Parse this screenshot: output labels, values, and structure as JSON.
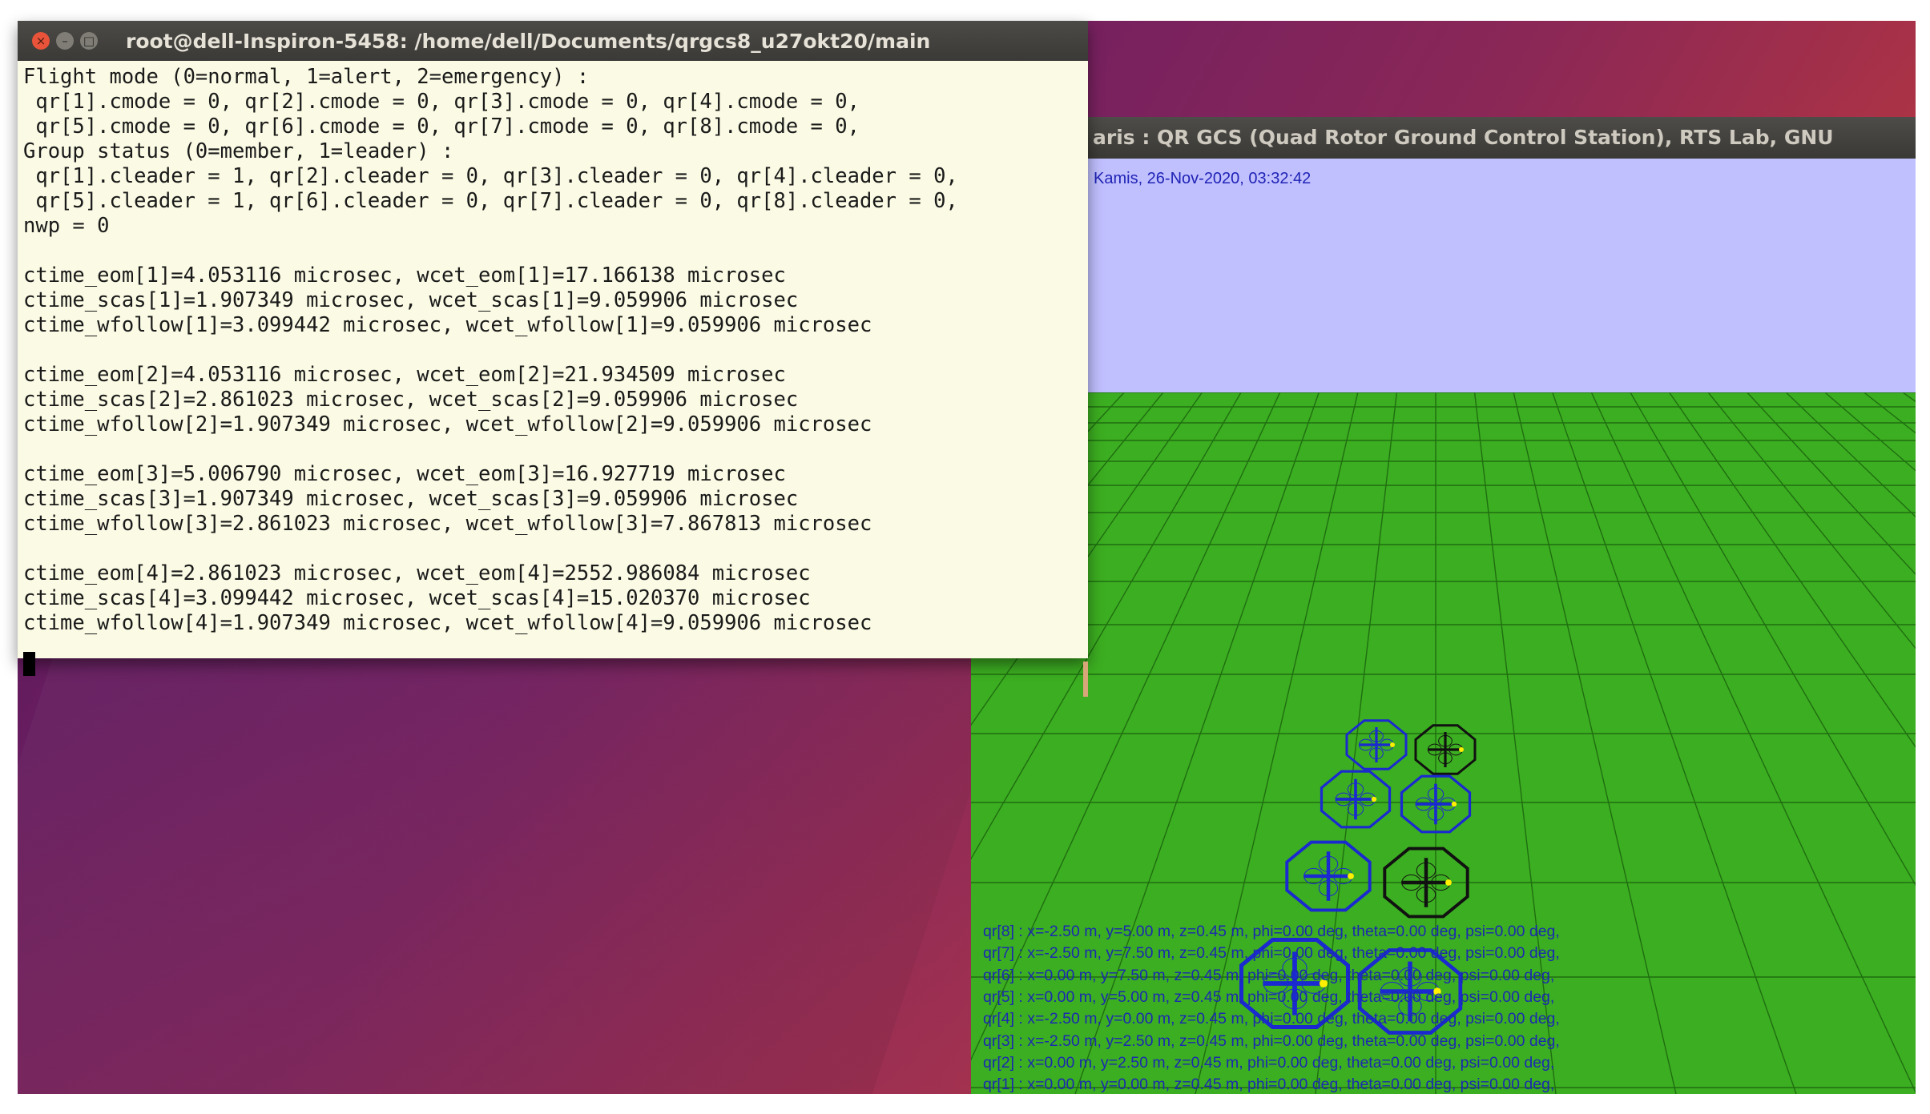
{
  "terminal": {
    "title": "root@dell-Inspiron-5458: /home/dell/Documents/qrgcs8_u27okt20/main",
    "lines": [
      "Flight mode (0=normal, 1=alert, 2=emergency) :",
      " qr[1].cmode = 0, qr[2].cmode = 0, qr[3].cmode = 0, qr[4].cmode = 0,",
      " qr[5].cmode = 0, qr[6].cmode = 0, qr[7].cmode = 0, qr[8].cmode = 0,",
      "Group status (0=member, 1=leader) :",
      " qr[1].cleader = 1, qr[2].cleader = 0, qr[3].cleader = 0, qr[4].cleader = 0,",
      " qr[5].cleader = 1, qr[6].cleader = 0, qr[7].cleader = 0, qr[8].cleader = 0,",
      "nwp = 0",
      "",
      "ctime_eom[1]=4.053116 microsec, wcet_eom[1]=17.166138 microsec",
      "ctime_scas[1]=1.907349 microsec, wcet_scas[1]=9.059906 microsec",
      "ctime_wfollow[1]=3.099442 microsec, wcet_wfollow[1]=9.059906 microsec",
      "",
      "ctime_eom[2]=4.053116 microsec, wcet_eom[2]=21.934509 microsec",
      "ctime_scas[2]=2.861023 microsec, wcet_scas[2]=9.059906 microsec",
      "ctime_wfollow[2]=1.907349 microsec, wcet_wfollow[2]=9.059906 microsec",
      "",
      "ctime_eom[3]=5.006790 microsec, wcet_eom[3]=16.927719 microsec",
      "ctime_scas[3]=1.907349 microsec, wcet_scas[3]=9.059906 microsec",
      "ctime_wfollow[3]=2.861023 microsec, wcet_wfollow[3]=7.867813 microsec",
      "",
      "ctime_eom[4]=2.861023 microsec, wcet_eom[4]=2552.986084 microsec",
      "ctime_scas[4]=3.099442 microsec, wcet_scas[4]=15.020370 microsec",
      "ctime_wfollow[4]=1.907349 microsec, wcet_wfollow[4]=9.059906 microsec"
    ],
    "close_glyph": "×",
    "min_glyph": "–",
    "max_glyph": "□"
  },
  "gcs": {
    "title": "aris : QR GCS (Quad Rotor Ground Control Station), RTS Lab, GNU",
    "datetime": "Kamis, 26-Nov-2020, 03:32:42",
    "sky_color": "#c1c0ff",
    "ground_color": "#3cae21",
    "status_lines": [
      "qr[8] : x=-2.50 m, y=5.00 m, z=0.45 m, phi=0.00 deg, theta=0.00 deg, psi=0.00 deg,",
      "qr[7] : x=-2.50 m, y=7.50 m, z=0.45 m, phi=0.00 deg, theta=0.00 deg, psi=0.00 deg,",
      "qr[6] : x=0.00 m, y=7.50 m, z=0.45 m, phi=0.00 deg, theta=0.00 deg, psi=0.00 deg,",
      "qr[5] : x=0.00 m, y=5.00 m, z=0.45 m, phi=0.00 deg, theta=0.00 deg, psi=0.00 deg,",
      "qr[4] : x=-2.50 m, y=0.00 m, z=0.45 m, phi=0.00 deg, theta=0.00 deg, psi=0.00 deg,",
      "qr[3] : x=-2.50 m, y=2.50 m, z=0.45 m, phi=0.00 deg, theta=0.00 deg, psi=0.00 deg,",
      "qr[2] : x=0.00 m, y=2.50 m, z=0.45 m, phi=0.00 deg, theta=0.00 deg, psi=0.00 deg,",
      "qr[1] : x=0.00 m, y=0.00 m, z=0.45 m, phi=0.00 deg, theta=0.00 deg, psi=0.00 deg,"
    ],
    "quadrotors": [
      {
        "name": "qr[8]",
        "color": "#1a2ad0"
      },
      {
        "name": "qr[7]",
        "color": "#111111"
      },
      {
        "name": "qr[6]",
        "color": "#1a2ad0"
      },
      {
        "name": "qr[5]",
        "color": "#1a2ad0"
      },
      {
        "name": "qr[4]",
        "color": "#1a2ad0"
      },
      {
        "name": "qr[3]",
        "color": "#111111"
      },
      {
        "name": "qr[2]",
        "color": "#1a2ad0"
      },
      {
        "name": "qr[1]",
        "color": "#1a2ad0"
      }
    ]
  }
}
